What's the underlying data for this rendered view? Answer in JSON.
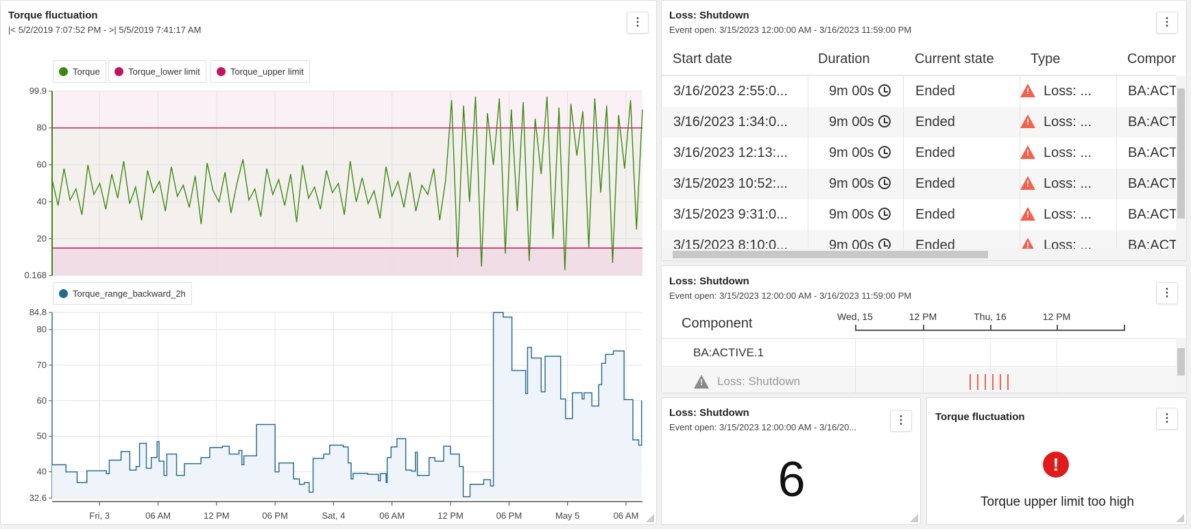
{
  "left_panel": {
    "title": "Torque fluctuation",
    "subtitle": "|< 5/2/2019 7:07:52 PM - >| 5/5/2019 7:41:17 AM",
    "menu_icon": "kebab-menu-icon"
  },
  "chart_data": [
    {
      "type": "line",
      "x_range": [
        "2019-05-02T19:07:52",
        "2019-05-05T07:41:17"
      ],
      "ylim": [
        0.168,
        99.9
      ],
      "yticks": [
        "99.9",
        "80",
        "60",
        "40",
        "20",
        "0.168"
      ],
      "grid": true,
      "legend_placement": "top-left",
      "series": [
        {
          "name": "Torque",
          "color": "#3b8a0f",
          "values": [
            52,
            38,
            58,
            41,
            47,
            33,
            60,
            44,
            50,
            36,
            55,
            42,
            62,
            39,
            48,
            30,
            57,
            45,
            51,
            35,
            59,
            43,
            49,
            37,
            54,
            28,
            61,
            46,
            40,
            56,
            34,
            50,
            63,
            41,
            47,
            32,
            58,
            44,
            52,
            38,
            55,
            29,
            60,
            42,
            48,
            36,
            57,
            45,
            50,
            33,
            62,
            40,
            53,
            39,
            46,
            31,
            59,
            43,
            51,
            37,
            56,
            35,
            49,
            44,
            58,
            30,
            52,
            95,
            10,
            92,
            40,
            97,
            5,
            88,
            60,
            96,
            12,
            90,
            35,
            94,
            8,
            85,
            55,
            97,
            20,
            91,
            3,
            93,
            65,
            89,
            15,
            96,
            45,
            92,
            7,
            87,
            58,
            95,
            25,
            90
          ]
        },
        {
          "name": "Torque_lower limit",
          "color": "#c4145f",
          "value": 15
        },
        {
          "name": "Torque_upper limit",
          "color": "#c4145f",
          "value": 80
        }
      ]
    },
    {
      "type": "area",
      "x_range": [
        "2019-05-02T19:07:52",
        "2019-05-05T07:41:17"
      ],
      "ylim": [
        32.6,
        84.8
      ],
      "yticks": [
        "84.8",
        "80",
        "70",
        "60",
        "50",
        "40",
        "32.6"
      ],
      "xticks": [
        {
          "label": "Fri, 3",
          "t": "2019-05-03T00:00"
        },
        {
          "label": "06 AM",
          "t": "2019-05-03T06:00"
        },
        {
          "label": "12 PM",
          "t": "2019-05-03T12:00"
        },
        {
          "label": "06 PM",
          "t": "2019-05-03T18:00"
        },
        {
          "label": "Sat, 4",
          "t": "2019-05-04T00:00"
        },
        {
          "label": "06 AM",
          "t": "2019-05-04T06:00"
        },
        {
          "label": "12 PM",
          "t": "2019-05-04T12:00"
        },
        {
          "label": "06 PM",
          "t": "2019-05-04T18:00"
        },
        {
          "label": "May 5",
          "t": "2019-05-05T00:00"
        },
        {
          "label": "06 AM",
          "t": "2019-05-05T06:00"
        }
      ],
      "grid": true,
      "legend_placement": "top-left",
      "series": [
        {
          "name": "Torque_range_backward_2h",
          "color": "#2b6e93",
          "step": true,
          "points": [
            [
              "2019-05-02T19:08",
              42
            ],
            [
              "2019-05-02T20:33",
              40
            ],
            [
              "2019-05-02T21:42",
              37
            ],
            [
              "2019-05-02T22:42",
              40.3
            ],
            [
              "2019-05-03T00:42",
              39.5
            ],
            [
              "2019-05-03T01:00",
              43.3
            ],
            [
              "2019-05-03T02:12",
              45.7
            ],
            [
              "2019-05-03T03:06",
              40.5
            ],
            [
              "2019-05-03T03:45",
              41.5
            ],
            [
              "2019-05-03T04:06",
              48
            ],
            [
              "2019-05-03T04:48",
              41
            ],
            [
              "2019-05-03T05:18",
              44
            ],
            [
              "2019-05-03T05:54",
              48.5
            ],
            [
              "2019-05-03T06:06",
              43
            ],
            [
              "2019-05-03T06:36",
              39
            ],
            [
              "2019-05-03T06:54",
              45
            ],
            [
              "2019-05-03T07:54",
              39
            ],
            [
              "2019-05-03T08:42",
              42.3
            ],
            [
              "2019-05-03T10:24",
              44
            ],
            [
              "2019-05-03T11:18",
              46.8
            ],
            [
              "2019-05-03T12:36",
              47.2
            ],
            [
              "2019-05-03T13:18",
              45
            ],
            [
              "2019-05-03T14:18",
              46
            ],
            [
              "2019-05-03T14:36",
              42
            ],
            [
              "2019-05-03T14:48",
              44.5
            ],
            [
              "2019-05-03T16:06",
              53.3
            ],
            [
              "2019-05-03T18:00",
              40
            ],
            [
              "2019-05-03T18:24",
              42.5
            ],
            [
              "2019-05-03T19:54",
              38
            ],
            [
              "2019-05-03T20:30",
              36.5
            ],
            [
              "2019-05-03T21:00",
              37
            ],
            [
              "2019-05-03T21:30",
              34.3
            ],
            [
              "2019-05-03T21:54",
              43.8
            ],
            [
              "2019-05-03T23:00",
              45
            ],
            [
              "2019-05-03T23:36",
              47.5
            ],
            [
              "2019-05-04T01:00",
              47
            ],
            [
              "2019-05-04T01:30",
              42.5
            ],
            [
              "2019-05-04T01:48",
              38
            ],
            [
              "2019-05-04T02:00",
              39.6
            ],
            [
              "2019-05-04T03:30",
              39.3
            ],
            [
              "2019-05-04T04:36",
              37.5
            ],
            [
              "2019-05-04T04:48",
              39.5
            ],
            [
              "2019-05-04T05:24",
              37
            ],
            [
              "2019-05-04T05:30",
              44
            ],
            [
              "2019-05-04T05:54",
              47
            ],
            [
              "2019-05-04T06:30",
              49.3
            ],
            [
              "2019-05-04T07:24",
              40.5
            ],
            [
              "2019-05-04T08:00",
              40.2
            ],
            [
              "2019-05-04T08:24",
              45.5
            ],
            [
              "2019-05-04T08:36",
              39
            ],
            [
              "2019-05-04T09:48",
              44
            ],
            [
              "2019-05-04T10:24",
              43
            ],
            [
              "2019-05-04T11:18",
              47.2
            ],
            [
              "2019-05-04T12:00",
              45
            ],
            [
              "2019-05-04T12:54",
              41.5
            ],
            [
              "2019-05-04T13:18",
              33
            ],
            [
              "2019-05-04T14:00",
              36.5
            ],
            [
              "2019-05-04T15:24",
              37.8
            ],
            [
              "2019-05-04T16:06",
              36
            ],
            [
              "2019-05-04T16:24",
              84.8
            ],
            [
              "2019-05-04T17:24",
              83.5
            ],
            [
              "2019-05-04T18:18",
              68.5
            ],
            [
              "2019-05-04T19:42",
              62
            ],
            [
              "2019-05-04T19:54",
              75
            ],
            [
              "2019-05-04T20:18",
              72
            ],
            [
              "2019-05-04T21:18",
              62.5
            ],
            [
              "2019-05-04T21:42",
              72.5
            ],
            [
              "2019-05-04T23:18",
              60.5
            ],
            [
              "2019-05-04T23:48",
              55
            ],
            [
              "2019-05-05T00:30",
              62.2
            ],
            [
              "2019-05-05T01:30",
              60.5
            ],
            [
              "2019-05-05T01:42",
              62.2
            ],
            [
              "2019-05-05T02:30",
              58.5
            ],
            [
              "2019-05-05T03:12",
              64.5
            ],
            [
              "2019-05-05T03:30",
              70.5
            ],
            [
              "2019-05-05T03:54",
              73
            ],
            [
              "2019-05-05T04:42",
              74
            ],
            [
              "2019-05-05T05:48",
              60.3
            ],
            [
              "2019-05-05T06:42",
              49
            ],
            [
              "2019-05-05T07:18",
              47.5
            ],
            [
              "2019-05-05T07:36",
              60
            ]
          ]
        }
      ]
    }
  ],
  "event_table": {
    "title": "Loss: Shutdown",
    "subtitle": "Event open: 3/15/2023 12:00:00 AM - 3/16/2023 11:59:00 PM",
    "columns": [
      "Start date",
      "Duration",
      "Current state",
      "Type",
      "Compor"
    ],
    "rows": [
      {
        "start": "3/16/2023 2:55:0...",
        "duration": "9m 00s",
        "state": "Ended",
        "type": "Loss: ...",
        "component": "BA:ACT"
      },
      {
        "start": "3/16/2023 1:34:0...",
        "duration": "9m 00s",
        "state": "Ended",
        "type": "Loss: ...",
        "component": "BA:ACT"
      },
      {
        "start": "3/16/2023 12:13:...",
        "duration": "9m 00s",
        "state": "Ended",
        "type": "Loss: ...",
        "component": "BA:ACT"
      },
      {
        "start": "3/15/2023 10:52:...",
        "duration": "9m 00s",
        "state": "Ended",
        "type": "Loss: ...",
        "component": "BA:ACT"
      },
      {
        "start": "3/15/2023 9:31:0...",
        "duration": "9m 00s",
        "state": "Ended",
        "type": "Loss: ...",
        "component": "BA:ACT"
      },
      {
        "start": "3/15/2023 8:10:0...",
        "duration": "9m 00s",
        "state": "Ended",
        "type": "Loss: ...",
        "component": "BA:ACT"
      }
    ]
  },
  "timeline": {
    "title": "Loss: Shutdown",
    "subtitle": "Event open: 3/15/2023 12:00:00 AM - 3/16/2023 11:59:00 PM",
    "column_header": "Component",
    "axis_labels": [
      "Wed, 15",
      "12 PM",
      "Thu, 16",
      "12 PM"
    ],
    "rows": [
      "BA:ACTIVE.1",
      "Loss: Shutdown"
    ],
    "event_count_marks": 6,
    "event_color": "#f0624d"
  },
  "count_tile": {
    "title": "Loss: Shutdown",
    "subtitle": "Event open: 3/15/2023 12:00:00 AM - 3/16/20...",
    "value": "6"
  },
  "alert_tile": {
    "title": "Torque fluctuation",
    "message": "Torque upper limit too high",
    "icon": "error-circle-icon",
    "icon_color": "#e01b1b"
  }
}
